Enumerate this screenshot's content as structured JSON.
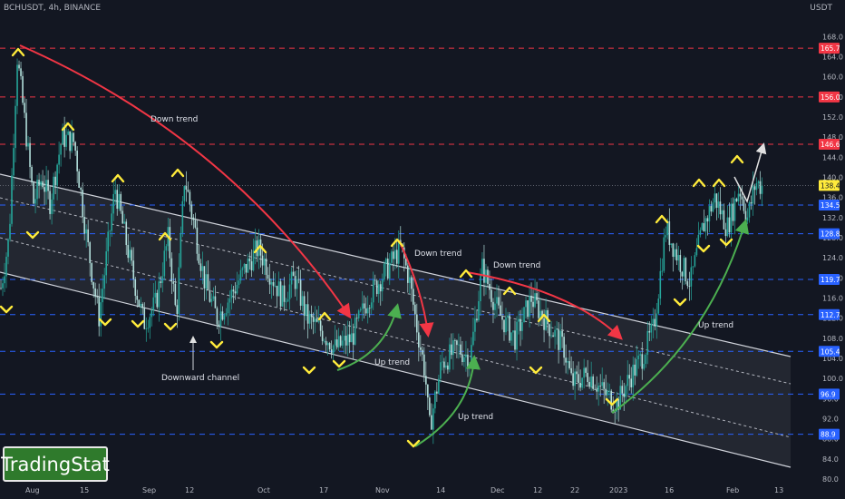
{
  "header": {
    "symbol": "BCHUSDT, 4h, BINANCE",
    "unit": "USDT"
  },
  "brand": "TradingStat",
  "chart_data": {
    "type": "candlestick",
    "ylim": [
      80,
      172
    ],
    "y_ticks": [
      80.0,
      84.0,
      88.0,
      92.0,
      96.0,
      100.0,
      104.0,
      108.0,
      112.0,
      116.0,
      120.0,
      124.0,
      128.0,
      132.0,
      136.0,
      140.0,
      144.0,
      148.0,
      152.0,
      156.0,
      160.0,
      164.0,
      168.0
    ],
    "x_ticks": [
      "Aug",
      "15",
      "Sep",
      "12",
      "Oct",
      "17",
      "Nov",
      "14",
      "Dec",
      "12",
      "22",
      "2023",
      "16",
      "Feb",
      "13"
    ],
    "levels": [
      {
        "value": 165.7,
        "label": "165.7",
        "color": "#f23645"
      },
      {
        "value": 156.0,
        "label": "156.0",
        "color": "#f23645"
      },
      {
        "value": 146.6,
        "label": "146.6",
        "color": "#f23645"
      },
      {
        "value": 134.5,
        "label": "134.5",
        "color": "#2962ff"
      },
      {
        "value": 128.8,
        "label": "128.8",
        "color": "#2962ff"
      },
      {
        "value": 119.7,
        "label": "119.7",
        "color": "#2962ff"
      },
      {
        "value": 112.7,
        "label": "112.7",
        "color": "#2962ff"
      },
      {
        "value": 105.4,
        "label": "105.4",
        "color": "#2962ff"
      },
      {
        "value": 96.9,
        "label": "96.9",
        "color": "#2962ff"
      },
      {
        "value": 88.9,
        "label": "88.9",
        "color": "#2962ff"
      }
    ],
    "last_price": {
      "value": 138.4,
      "label": "138.4"
    },
    "annotations": [
      "Down trend",
      "Down trend",
      "Down trend",
      "Up trend",
      "Up trend",
      "Up trend",
      "Downward channel"
    ],
    "price_path": [
      [
        0,
        118
      ],
      [
        0.01,
        128
      ],
      [
        0.02,
        164
      ],
      [
        0.03,
        150
      ],
      [
        0.04,
        135
      ],
      [
        0.05,
        140
      ],
      [
        0.06,
        135
      ],
      [
        0.075,
        148
      ],
      [
        0.09,
        147
      ],
      [
        0.105,
        128
      ],
      [
        0.12,
        112
      ],
      [
        0.14,
        138
      ],
      [
        0.16,
        122
      ],
      [
        0.175,
        111
      ],
      [
        0.19,
        115
      ],
      [
        0.205,
        128
      ],
      [
        0.215,
        112
      ],
      [
        0.225,
        140
      ],
      [
        0.235,
        132
      ],
      [
        0.25,
        119
      ],
      [
        0.265,
        112
      ],
      [
        0.28,
        116
      ],
      [
        0.3,
        122
      ],
      [
        0.315,
        126
      ],
      [
        0.33,
        121
      ],
      [
        0.345,
        116
      ],
      [
        0.36,
        120
      ],
      [
        0.375,
        112
      ],
      [
        0.39,
        110
      ],
      [
        0.41,
        106
      ],
      [
        0.43,
        108
      ],
      [
        0.45,
        116
      ],
      [
        0.47,
        121
      ],
      [
        0.49,
        126
      ],
      [
        0.5,
        120
      ],
      [
        0.51,
        110
      ],
      [
        0.52,
        101
      ],
      [
        0.525,
        90
      ],
      [
        0.54,
        103
      ],
      [
        0.56,
        106
      ],
      [
        0.575,
        104
      ],
      [
        0.59,
        122
      ],
      [
        0.61,
        113
      ],
      [
        0.63,
        108
      ],
      [
        0.65,
        116
      ],
      [
        0.67,
        111
      ],
      [
        0.69,
        106
      ],
      [
        0.7,
        99
      ],
      [
        0.72,
        101
      ],
      [
        0.74,
        97
      ],
      [
        0.755,
        95
      ],
      [
        0.77,
        100
      ],
      [
        0.785,
        104
      ],
      [
        0.8,
        110
      ],
      [
        0.815,
        130
      ],
      [
        0.83,
        124
      ],
      [
        0.845,
        119
      ],
      [
        0.86,
        130
      ],
      [
        0.875,
        136
      ],
      [
        0.89,
        130
      ],
      [
        0.905,
        138
      ],
      [
        0.915,
        132
      ],
      [
        0.925,
        139
      ],
      [
        0.935,
        138
      ]
    ]
  }
}
